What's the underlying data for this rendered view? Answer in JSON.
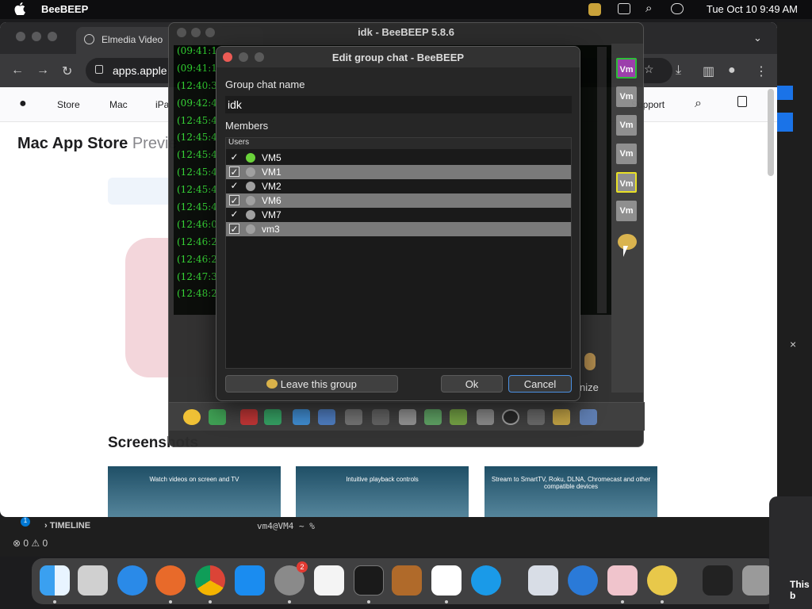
{
  "menubar": {
    "apple": "",
    "app_name": "BeeBEEP",
    "clock": "Tue Oct 10  9:49 AM"
  },
  "browser": {
    "tab_title": "Elmedia Video",
    "url": "apps.apple",
    "apple_nav": [
      "Store",
      "Mac",
      "iPa",
      "Support"
    ],
    "store_title": "Mac App Store",
    "store_preview": "Previe",
    "screenshots_heading": "Screenshots",
    "shots": [
      "Watch videos on screen and TV",
      "Intuitive playback controls",
      "Stream to SmartTV, Roku, DLNA, Chromecast and other compatible devices"
    ]
  },
  "beebeep": {
    "window_title": "idk - BeeBEEP 5.8.6",
    "chat_times": [
      "(09:41:1",
      "(09:41:1",
      "(12:40:3",
      "(09:42:4",
      "(12:45:4",
      "(12:45:4",
      "(12:45:4",
      "(12:45:4",
      "(12:45:4",
      "(12:45:4",
      "(12:46:0",
      "(12:46:2",
      "(12:46:2",
      "(12:47:3",
      "(12:48:2"
    ],
    "user_badges": [
      "Vm",
      "Vm",
      "Vm",
      "Vm",
      "Vm",
      "Vm"
    ],
    "mic_label": "nize"
  },
  "dialog": {
    "title": "Edit group chat - BeeBEEP",
    "group_name_label": "Group chat name",
    "group_name_value": "idk",
    "members_label": "Members",
    "list_header": "Users",
    "members": [
      {
        "check": "✓",
        "name": "VM5",
        "status_color": "#6ad23a"
      },
      {
        "check": "✓",
        "name": "VM1",
        "status_color": "#a0a0a0"
      },
      {
        "check": "✓",
        "name": "VM2",
        "status_color": "#a0a0a0"
      },
      {
        "check": "✓",
        "name": "VM6",
        "status_color": "#a0a0a0"
      },
      {
        "check": "✓",
        "name": "VM7",
        "status_color": "#a0a0a0"
      },
      {
        "check": "✓",
        "name": "vm3",
        "status_color": "#a0a0a0"
      }
    ],
    "leave_button": "Leave this group",
    "ok_button": "Ok",
    "cancel_button": "Cancel"
  },
  "vscode": {
    "timeline_label": "TIMELINE",
    "terminal_prompt": "vm4@VM4 ~ %",
    "status": "⊗ 0 ⚠ 0",
    "badge": "1"
  },
  "dock": {
    "settings_badge": "2",
    "notification_text": "This b"
  },
  "colors": {
    "chat_green": "#31d531",
    "accent_blue": "#4a90e2",
    "vm_active_border": "#2ec43a",
    "vm_purple": "#a040b0",
    "vm_yellow_border": "#e8e020"
  }
}
